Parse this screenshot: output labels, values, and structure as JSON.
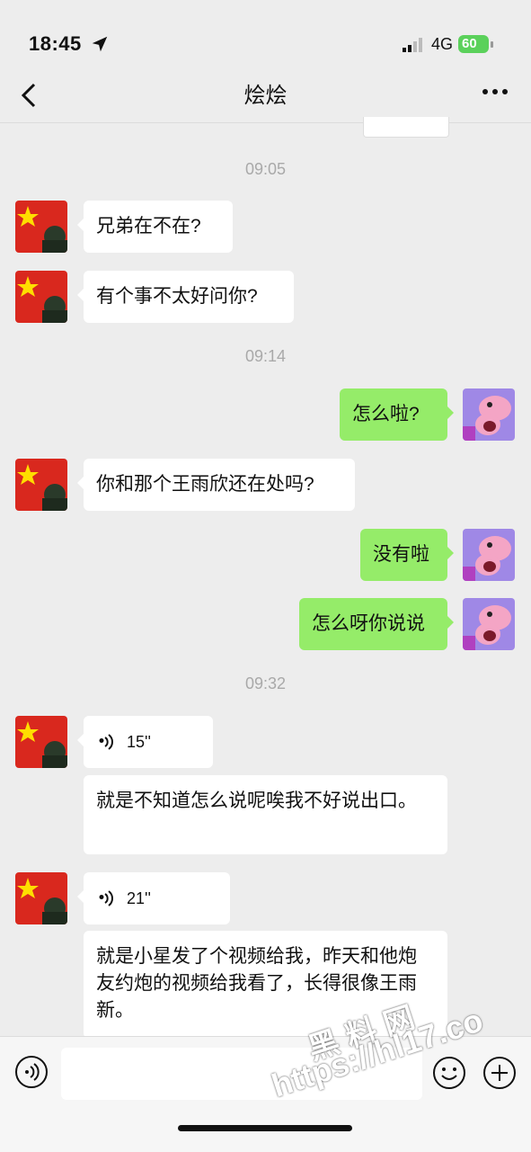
{
  "status_bar": {
    "time": "18:45",
    "network": "4G",
    "battery": "60"
  },
  "header": {
    "title": "烩烩"
  },
  "timestamps": [
    "09:05",
    "09:14",
    "09:32"
  ],
  "messages": [
    {
      "from": "friend",
      "text": "兄弟在不在?"
    },
    {
      "from": "friend",
      "text": "有个事不太好问你?"
    },
    {
      "from": "me",
      "text": "怎么啦?"
    },
    {
      "from": "friend",
      "text": "你和那个王雨欣还在处吗?"
    },
    {
      "from": "me",
      "text": "没有啦"
    },
    {
      "from": "me",
      "text": "怎么呀你说说"
    },
    {
      "from": "friend",
      "type": "voice",
      "duration": "15''"
    },
    {
      "from": "friend",
      "type": "transcript",
      "text": "就是不知道怎么说呢唉我不好说出口。"
    },
    {
      "from": "friend",
      "type": "voice",
      "duration": "21''"
    },
    {
      "from": "friend",
      "type": "transcript",
      "text": "就是小星发了个视频给我，昨天和他炮友约炮的视频给我看了，长得很像王雨新。"
    }
  ],
  "watermark": {
    "line1": "黑料网",
    "line2": "https://hl17.co"
  },
  "colors": {
    "my_bubble": "#95ec69",
    "background": "#ededed"
  }
}
